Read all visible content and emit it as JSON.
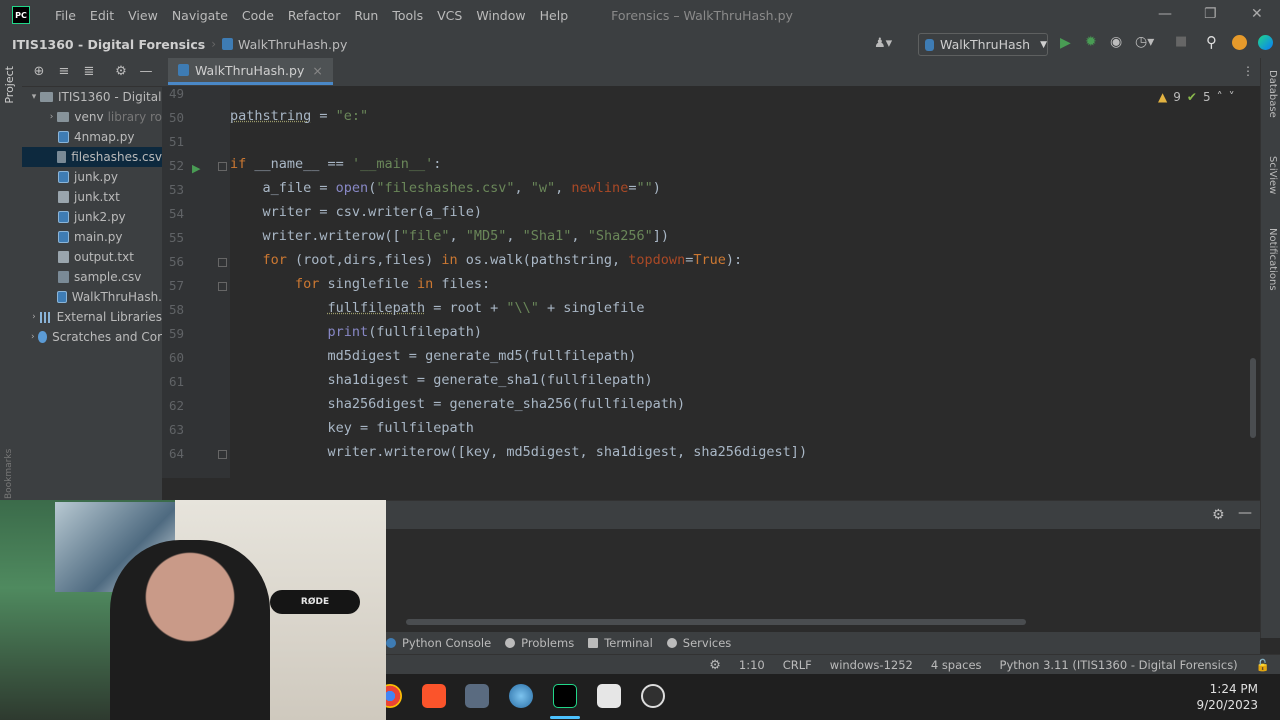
{
  "window": {
    "title": "Forensics – WalkThruHash.py",
    "logo": "PC",
    "controls": [
      "minimize-icon",
      "restore-icon",
      "close-icon"
    ]
  },
  "menu": [
    "File",
    "Edit",
    "View",
    "Navigate",
    "Code",
    "Refactor",
    "Run",
    "Tools",
    "VCS",
    "Window",
    "Help"
  ],
  "navbar": {
    "project": "ITIS1360 - Digital Forensics",
    "file": "WalkThruHash.py",
    "run_config": "WalkThruHash"
  },
  "sidebar": {
    "tab_label": "Project",
    "bookmarks_label": "Bookmarks",
    "tree": [
      {
        "label": "ITIS1360 - Digital",
        "type": "folder",
        "level": 0,
        "expanded": true
      },
      {
        "label": "venv",
        "suffix": "library ro",
        "type": "folder",
        "level": 1,
        "expanded": false
      },
      {
        "label": "4nmap.py",
        "type": "py",
        "level": 1
      },
      {
        "label": "fileshashes.csv",
        "type": "csv",
        "level": 1,
        "selected": true
      },
      {
        "label": "junk.py",
        "type": "py",
        "level": 1
      },
      {
        "label": "junk.txt",
        "type": "txt",
        "level": 1
      },
      {
        "label": "junk2.py",
        "type": "py",
        "level": 1
      },
      {
        "label": "main.py",
        "type": "py",
        "level": 1
      },
      {
        "label": "output.txt",
        "type": "txt",
        "level": 1
      },
      {
        "label": "sample.csv",
        "type": "csv",
        "level": 1
      },
      {
        "label": "WalkThruHash.",
        "type": "py",
        "level": 1
      },
      {
        "label": "External Libraries",
        "type": "lib",
        "level": 0,
        "expanded": false
      },
      {
        "label": "Scratches and Cor",
        "type": "scratch",
        "level": 0,
        "expanded": false
      }
    ]
  },
  "editor": {
    "tab": "WalkThruHash.py",
    "warnings": "9",
    "weak_warnings": "5",
    "lines": [
      {
        "n": "49",
        "tokens": []
      },
      {
        "n": "50",
        "tokens": [
          {
            "t": "pathstring",
            "c": "underline"
          },
          {
            "t": " = "
          },
          {
            "t": "\"e:\"",
            "c": "str"
          }
        ]
      },
      {
        "n": "51",
        "tokens": []
      },
      {
        "n": "52",
        "tokens": [
          {
            "t": "if",
            "c": "kw"
          },
          {
            "t": " __name__ == "
          },
          {
            "t": "'__main__'",
            "c": "str"
          },
          {
            "t": ":"
          }
        ]
      },
      {
        "n": "53",
        "tokens": [
          {
            "t": "    a_file = "
          },
          {
            "t": "open",
            "c": "builtin"
          },
          {
            "t": "("
          },
          {
            "t": "\"fileshashes.csv\"",
            "c": "str"
          },
          {
            "t": ", "
          },
          {
            "t": "\"w\"",
            "c": "str"
          },
          {
            "t": ", "
          },
          {
            "t": "newline",
            "c": "param"
          },
          {
            "t": "="
          },
          {
            "t": "\"\"",
            "c": "str"
          },
          {
            "t": ")"
          }
        ]
      },
      {
        "n": "54",
        "tokens": [
          {
            "t": "    writer = csv.writer(a_file)"
          }
        ]
      },
      {
        "n": "55",
        "tokens": [
          {
            "t": "    writer.writerow(["
          },
          {
            "t": "\"file\"",
            "c": "str"
          },
          {
            "t": ", "
          },
          {
            "t": "\"MD5\"",
            "c": "str"
          },
          {
            "t": ", "
          },
          {
            "t": "\"Sha1\"",
            "c": "str"
          },
          {
            "t": ", "
          },
          {
            "t": "\"Sha256\"",
            "c": "str"
          },
          {
            "t": "])"
          }
        ]
      },
      {
        "n": "56",
        "tokens": [
          {
            "t": "    "
          },
          {
            "t": "for",
            "c": "kw"
          },
          {
            "t": " (root,dirs,files) "
          },
          {
            "t": "in",
            "c": "kw"
          },
          {
            "t": " os.walk(pathstring, "
          },
          {
            "t": "topdown",
            "c": "param"
          },
          {
            "t": "="
          },
          {
            "t": "True",
            "c": "kw"
          },
          {
            "t": "):"
          }
        ]
      },
      {
        "n": "57",
        "tokens": [
          {
            "t": "        "
          },
          {
            "t": "for",
            "c": "kw"
          },
          {
            "t": " singlefile "
          },
          {
            "t": "in",
            "c": "kw"
          },
          {
            "t": " files:"
          }
        ]
      },
      {
        "n": "58",
        "tokens": [
          {
            "t": "            "
          },
          {
            "t": "fullfilepath",
            "c": "underline"
          },
          {
            "t": " = root + "
          },
          {
            "t": "\"\\\\\"",
            "c": "str"
          },
          {
            "t": " + singlefile"
          }
        ]
      },
      {
        "n": "59",
        "tokens": [
          {
            "t": "            "
          },
          {
            "t": "print",
            "c": "builtin"
          },
          {
            "t": "(fullfilepath)"
          }
        ]
      },
      {
        "n": "60",
        "tokens": [
          {
            "t": "            md5digest = generate_md5(fullfilepath)"
          }
        ]
      },
      {
        "n": "61",
        "tokens": [
          {
            "t": "            sha1digest = generate_sha1(fullfilepath)"
          }
        ]
      },
      {
        "n": "62",
        "tokens": [
          {
            "t": "            sha256digest = generate_sha256(fullfilepath)"
          }
        ]
      },
      {
        "n": "63",
        "tokens": [
          {
            "t": "            key = fullfilepath"
          }
        ]
      },
      {
        "n": "64",
        "tokens": [
          {
            "t": "            writer.writerow([key, md5digest, sha1digest, sha256digest])"
          }
        ]
      }
    ]
  },
  "right_strip": [
    "Database",
    "SciView",
    "Notifications"
  ],
  "bottom_tabs": [
    "Python Console",
    "Problems",
    "Terminal",
    "Services"
  ],
  "status": {
    "position": "1:10",
    "line_sep": "CRLF",
    "encoding": "windows-1252",
    "indent": "4 spaces",
    "interpreter": "Python 3.11 (ITIS1360 - Digital Forensics)"
  },
  "taskbar": {
    "time": "1:24 PM",
    "date": "9/20/2023",
    "apps": [
      "chrome-icon",
      "brave-icon",
      "app-icon",
      "browser-icon",
      "pycharm-icon",
      "h-app-icon",
      "obs-icon"
    ]
  },
  "webcam": {
    "mic_label": "RØDE"
  },
  "colors": {
    "accent": "#4a88c7",
    "keyword": "#cc7832",
    "string": "#6a8759",
    "run": "#499c54"
  }
}
